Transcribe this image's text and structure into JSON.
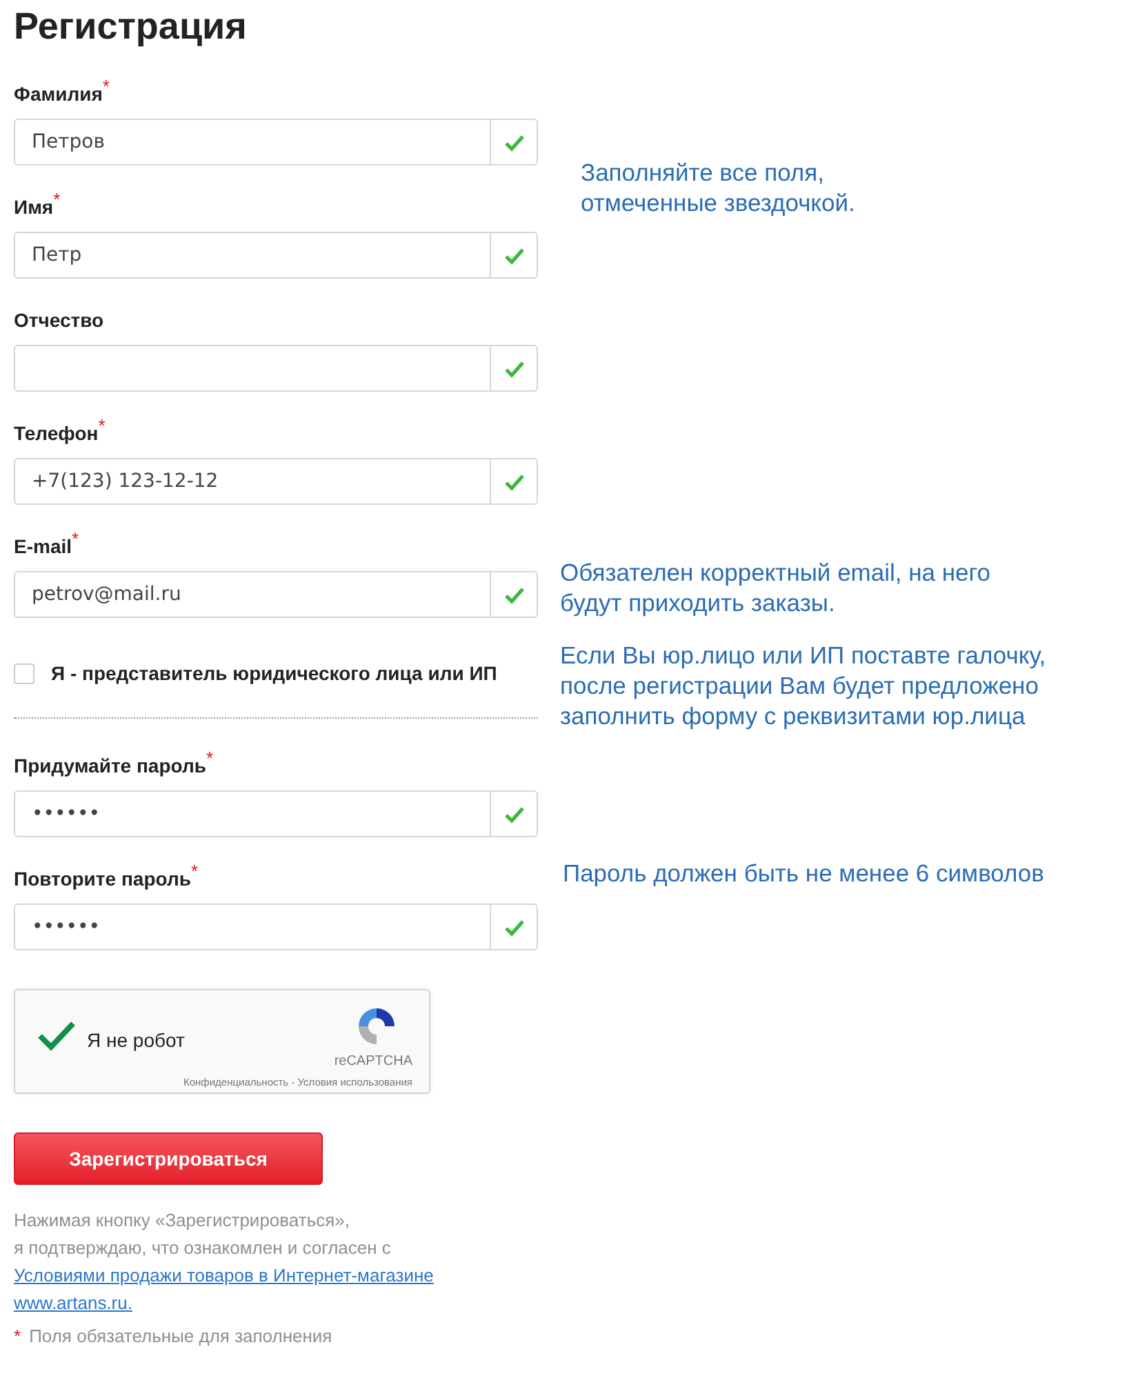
{
  "title": "Регистрация",
  "fields": [
    {
      "label": "Фамилия",
      "required": true,
      "value": "Петров",
      "valid": true
    },
    {
      "label": "Имя",
      "required": true,
      "value": "Петр",
      "valid": true
    },
    {
      "label": "Отчество",
      "required": false,
      "valid": true
    },
    {
      "label": "Телефон",
      "required": true,
      "value": "+7(123) 123-12-12",
      "valid": true
    },
    {
      "label": "E-mail",
      "required": true,
      "value": "petrov@mail.ru",
      "valid": true
    },
    {
      "label": "Придумайте пароль",
      "required": true,
      "value": "••••••",
      "valid": true
    },
    {
      "label": "Повторите пароль",
      "required": true,
      "value": "••••••",
      "valid": true
    }
  ],
  "required_mark": "*",
  "legal_entity_checkbox": {
    "label": "Я - представитель юридического лица или ИП",
    "checked": false
  },
  "notes": [
    {
      "text": "Заполняйте все поля,\nотмеченные звездочкой."
    },
    {
      "text": "Обязателен корректный email, на него\nбудут приходить заказы."
    },
    {
      "text": "Если Вы юр.лицо или ИП поставте галочку,\nпосле регистрации Вам будет предложено\nзаполнить форму с реквизитами юр.лица"
    },
    {
      "text": "Пароль должен быть не менее 6 символов"
    }
  ],
  "captcha": {
    "label": "Я не робот",
    "checked": true,
    "brand": "reCAPTCHA",
    "footer": "Конфиденциальность - Условия использования"
  },
  "submit_button": "Зарегистрироваться",
  "legal_text_lines": [
    "Нажимая кнопку «Зарегистрироваться»,",
    "я подтверждаю, что ознакомлен и согласен с"
  ],
  "legal_links": [
    "Условиями продажи товаров в Интернет-магазине",
    "www.artans.ru."
  ],
  "footnote": "Поля обязательные для заполнения"
}
